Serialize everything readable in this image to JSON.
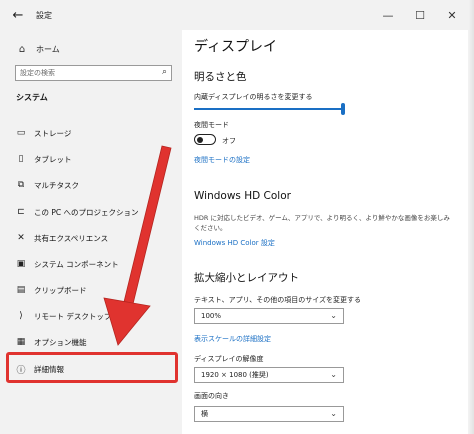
{
  "window": {
    "title": "設定",
    "back_glyph": "←",
    "minimize_glyph": "—",
    "maximize_glyph": "☐",
    "close_glyph": "✕"
  },
  "sidebar": {
    "home_label": "ホーム",
    "search_placeholder": "設定の検索",
    "section_title": "システム",
    "items": [
      {
        "label": "ストレージ",
        "icon": "storage-icon"
      },
      {
        "label": "タブレット",
        "icon": "tablet-icon"
      },
      {
        "label": "マルチタスク",
        "icon": "multitask-icon"
      },
      {
        "label": "この PC へのプロジェクション",
        "icon": "projection-icon"
      },
      {
        "label": "共有エクスペリエンス",
        "icon": "shared-experience-icon"
      },
      {
        "label": "システム コンポーネント",
        "icon": "system-components-icon"
      },
      {
        "label": "クリップボード",
        "icon": "clipboard-icon"
      },
      {
        "label": "リモート デスクトップ",
        "icon": "remote-desktop-icon"
      },
      {
        "label": "オプション機能",
        "icon": "optional-features-icon"
      },
      {
        "label": "詳細情報",
        "icon": "info-icon"
      }
    ],
    "highlighted_item": "詳細情報"
  },
  "content": {
    "page_title": "ディスプレイ",
    "brightness": {
      "heading": "明るさと色",
      "slider_label": "内蔵ディスプレイの明るさを変更する",
      "slider_level": 1.0
    },
    "night_light": {
      "label": "夜間モード",
      "state": "オフ",
      "settings_link": "夜間モードの設定"
    },
    "hdr": {
      "heading": "Windows HD Color",
      "description": "HDR に対応したビデオ、ゲーム、アプリで、より明るく、より鮮やかな画像をお楽しみください。",
      "link": "Windows HD Color 設定"
    },
    "scale_layout": {
      "heading": "拡大縮小とレイアウト",
      "scale_label": "テキスト、アプリ、その他の項目のサイズを変更する",
      "scale_value": "100%",
      "advanced_link": "表示スケールの詳細設定",
      "resolution_label": "ディスプレイの解像度",
      "resolution_value": "1920 × 1080 (推奨)",
      "orientation_label": "画面の向き",
      "orientation_value": "横"
    }
  },
  "colors": {
    "accent": "#1a6fc4",
    "highlight": "#e0332f"
  }
}
